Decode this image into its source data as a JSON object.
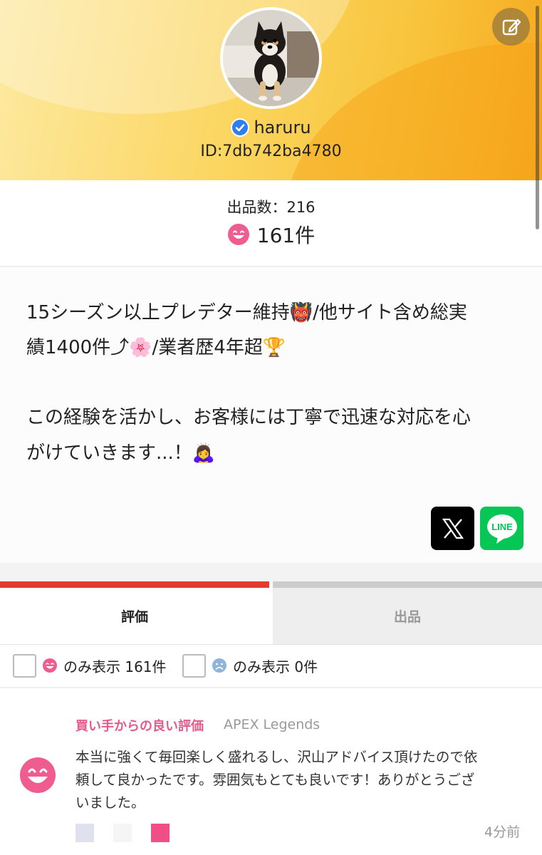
{
  "profile": {
    "username": "haruru",
    "user_id": "ID:7db742ba4780",
    "verified": true,
    "avatar_icon": "shiba-puppy-avatar",
    "edit_icon": "edit-icon",
    "banner_colors": [
      "#fde9a0",
      "#fbd55e",
      "#f6a81f"
    ]
  },
  "stats": {
    "listing_count": "出品数：216",
    "rating_count": "161件",
    "rating_icon": "smile-face-icon"
  },
  "bio": {
    "line1": "15シーズン以上プレデター維持👹/他サイト含め総実",
    "line2": "績1400件⤴︎🌸/業者歴4年超🏆",
    "line3": "この経験を活かし、お客様には丁寧で迅速な対応を心",
    "line4": "がけていきます...！🙇‍♀️"
  },
  "social": {
    "x_icon": "x-logo-icon",
    "line_label": "LINE"
  },
  "tabs": [
    {
      "label": "評価",
      "active": true
    },
    {
      "label": "出品",
      "active": false
    }
  ],
  "filters": [
    {
      "label": "のみ表示 161件",
      "icon": "smile-face-icon",
      "checked": false
    },
    {
      "label": "のみ表示 0件",
      "icon": "sad-face-icon",
      "checked": false
    }
  ],
  "review": {
    "type": "買い手からの良い評価",
    "game": "APEX Legends",
    "line1": "本当に強くて毎回楽しく盛れるし、沢山アドバイス頂けたので依",
    "line2": "頼して良かったです。雰囲気もとても良いです！ありがとうござ",
    "line3": "いました。",
    "time": "4分前",
    "swatch_colors": [
      "#dfe1ee",
      "#f5f5f5",
      "#ef4f86"
    ]
  },
  "colors": {
    "accent_red": "#e33b30",
    "pink": "#e35a8c",
    "line_green": "#06c755"
  }
}
